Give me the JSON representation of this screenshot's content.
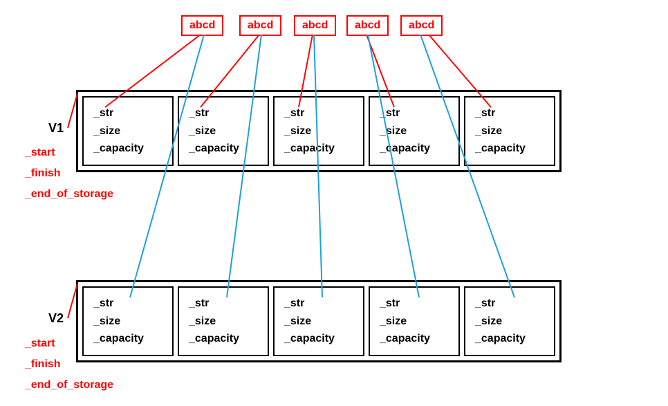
{
  "abcd_boxes": [
    "abcd",
    "abcd",
    "abcd",
    "abcd",
    "abcd"
  ],
  "vectors": {
    "v1": {
      "name": "V1",
      "labels": [
        "_start",
        "_finish",
        "_end_of_storage"
      ],
      "cells": [
        {
          "f1": "_str",
          "f2": "_size",
          "f3": "_capacity"
        },
        {
          "f1": "_str",
          "f2": "_size",
          "f3": "_capacity"
        },
        {
          "f1": "_str",
          "f2": "_size",
          "f3": "_capacity"
        },
        {
          "f1": "_str",
          "f2": "_size",
          "f3": "_capacity"
        },
        {
          "f1": "_str",
          "f2": "_size",
          "f3": "_capacity"
        }
      ]
    },
    "v2": {
      "name": "V2",
      "labels": [
        "_start",
        "_finish",
        "_end_of_storage"
      ],
      "cells": [
        {
          "f1": "_str",
          "f2": "_size",
          "f3": "_capacity"
        },
        {
          "f1": "_str",
          "f2": "_size",
          "f3": "_capacity"
        },
        {
          "f1": "_str",
          "f2": "_size",
          "f3": "_capacity"
        },
        {
          "f1": "_str",
          "f2": "_size",
          "f3": "_capacity"
        },
        {
          "f1": "_str",
          "f2": "_size",
          "f3": "_capacity"
        }
      ]
    }
  }
}
